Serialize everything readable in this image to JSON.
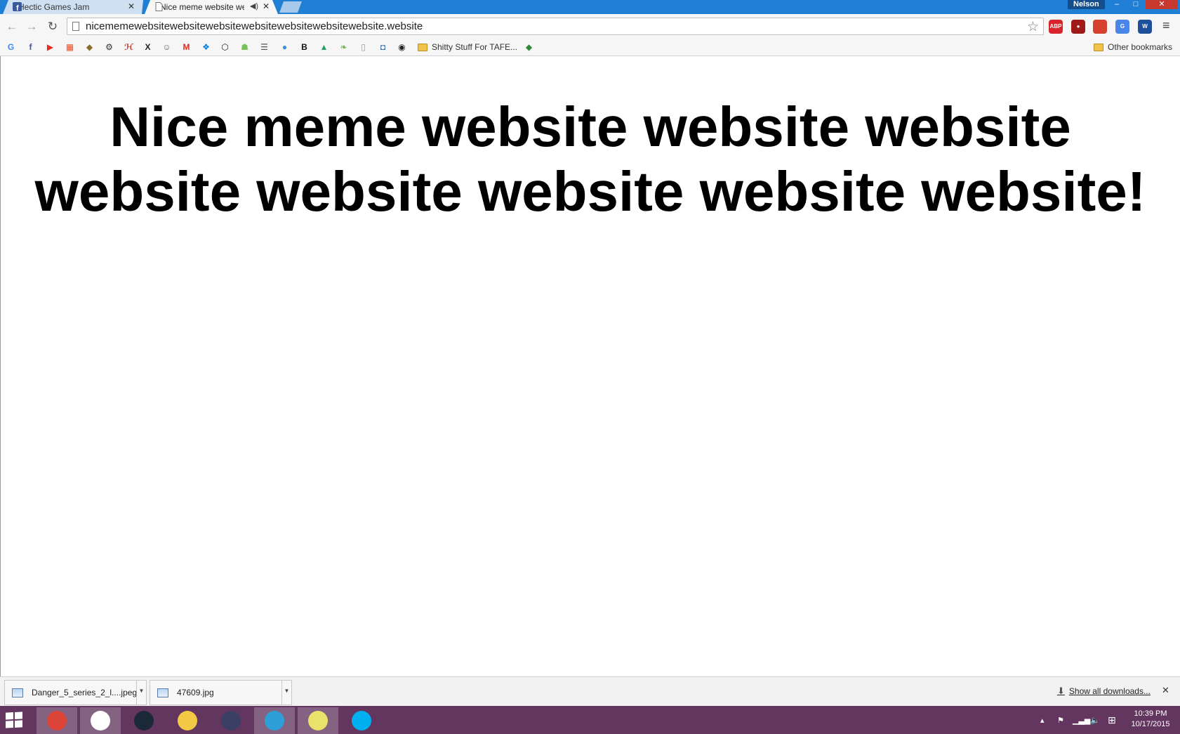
{
  "tabs": [
    {
      "title": "Hectic Games Jam",
      "favicon": "facebook-icon",
      "active": false
    },
    {
      "title": "Nice meme website we",
      "favicon": "page-icon",
      "active": true,
      "audio": true
    }
  ],
  "profile": {
    "name": "Nelson"
  },
  "window_controls": {
    "minimize": "–",
    "maximize": "□",
    "close": "✕"
  },
  "toolbar": {
    "back": "←",
    "forward": "→",
    "reload": "↻",
    "url": "nicememewebsitewebsitewebsitewebsitewebsitewebsitewebsite.website",
    "star": "☆",
    "menu": "≡",
    "extensions": [
      {
        "name": "adblock-plus-icon",
        "label": "ABP",
        "color": "#d8242a"
      },
      {
        "name": "ublock-icon",
        "label": "●",
        "color": "#a01a1a"
      },
      {
        "name": "bookmark-ext-icon",
        "label": "",
        "color": "#d5402f"
      },
      {
        "name": "google-translate-icon",
        "label": "G",
        "color": "#4a86e8"
      },
      {
        "name": "word-icon",
        "label": "W",
        "color": "#1e4f9a"
      }
    ]
  },
  "bookmarks": {
    "icons": [
      {
        "name": "google-icon",
        "glyph": "G",
        "color": "#4285f4"
      },
      {
        "name": "facebook-icon",
        "glyph": "f",
        "color": "#3b5998"
      },
      {
        "name": "youtube-icon",
        "glyph": "▶",
        "color": "#e52d27"
      },
      {
        "name": "microsoft-icon",
        "glyph": "▦",
        "color": "#f25022"
      },
      {
        "name": "shield-icon",
        "glyph": "◆",
        "color": "#8a6d2a"
      },
      {
        "name": "gear-icon",
        "glyph": "⚙",
        "color": "#333333"
      },
      {
        "name": "hackaday-icon",
        "glyph": "ℋ",
        "color": "#c0392b"
      },
      {
        "name": "x-icon",
        "glyph": "X",
        "color": "#222222"
      },
      {
        "name": "reddit-icon",
        "glyph": "☺",
        "color": "#666666"
      },
      {
        "name": "gmail-icon",
        "glyph": "M",
        "color": "#d93025"
      },
      {
        "name": "dropbox-icon",
        "glyph": "❖",
        "color": "#007ee5"
      },
      {
        "name": "unity-icon",
        "glyph": "⬡",
        "color": "#222222"
      },
      {
        "name": "android-icon",
        "glyph": "☗",
        "color": "#78c257"
      },
      {
        "name": "document-icon",
        "glyph": "☰",
        "color": "#555555"
      },
      {
        "name": "water-drop-icon",
        "glyph": "●",
        "color": "#3a8fd8"
      },
      {
        "name": "b-icon",
        "glyph": "B",
        "color": "#111111"
      },
      {
        "name": "google-drive-icon",
        "glyph": "▲",
        "color": "#1fa463"
      },
      {
        "name": "leaf-icon",
        "glyph": "❧",
        "color": "#6ab04c"
      },
      {
        "name": "blank-page-icon",
        "glyph": "▯",
        "color": "#999999"
      },
      {
        "name": "cylinder-icon",
        "glyph": "◘",
        "color": "#3e6fb0"
      },
      {
        "name": "github-icon",
        "glyph": "◉",
        "color": "#222222"
      }
    ],
    "folder": "Shitty Stuff For TAFE...",
    "green_icon": {
      "name": "green-badge-icon",
      "glyph": "◆",
      "color": "#2e8b3e"
    },
    "other": "Other bookmarks"
  },
  "page": {
    "headline": "Nice meme website website website website website website website website!"
  },
  "downloads": {
    "items": [
      {
        "filename": "Danger_5_series_2_l....jpeg"
      },
      {
        "filename": "47609.jpg"
      }
    ],
    "show_all": "Show all downloads...",
    "close": "✕"
  },
  "taskbar": {
    "apps": [
      {
        "name": "chrome-icon",
        "color": "#db4437",
        "running": true
      },
      {
        "name": "unity-icon",
        "color": "#ffffff",
        "running": true
      },
      {
        "name": "steam-icon",
        "color": "#1b2838",
        "running": false
      },
      {
        "name": "file-explorer-icon",
        "color": "#f3c845",
        "running": false
      },
      {
        "name": "crescent-app-icon",
        "color": "#3b3f66",
        "running": false
      },
      {
        "name": "gear-app-icon",
        "color": "#2e9fd8",
        "running": true
      },
      {
        "name": "sticky-notes-icon",
        "color": "#e9e36b",
        "running": true
      },
      {
        "name": "skype-icon",
        "color": "#00aff0",
        "running": false
      }
    ],
    "tray": {
      "chevron": "▴",
      "flag": "⚑",
      "signal": "▁▃▅",
      "volume": "🔈",
      "windows": "⊞"
    },
    "time": "10:39 PM",
    "date": "10/17/2015"
  }
}
